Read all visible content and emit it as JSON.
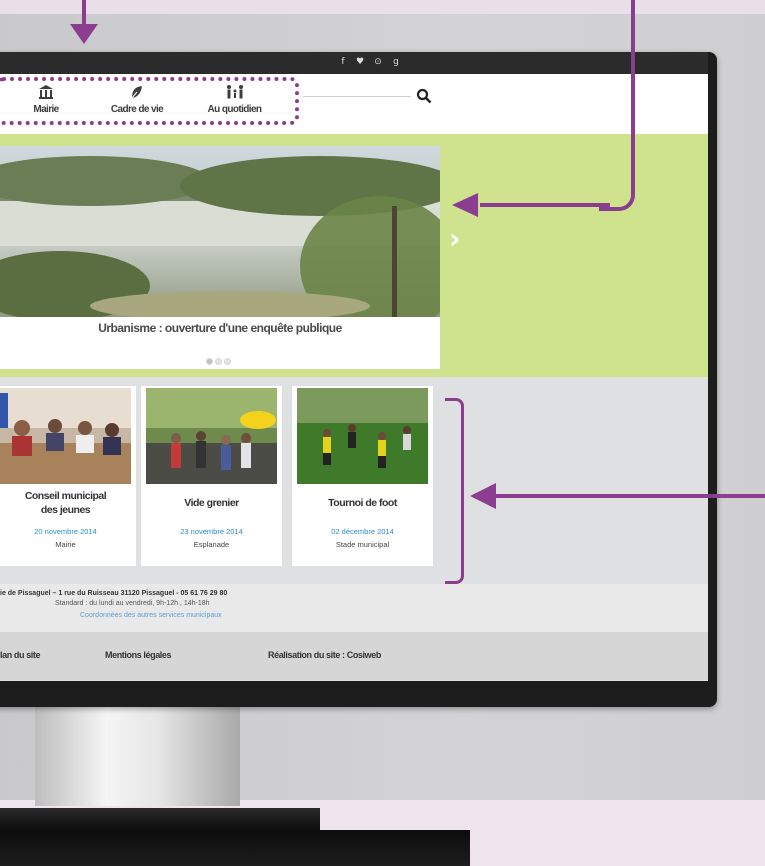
{
  "nav": {
    "items": [
      {
        "label": "Mairie",
        "icon": "town-hall-icon"
      },
      {
        "label": "Cadre de vie",
        "icon": "leaf-icon"
      },
      {
        "label": "Au quotidien",
        "icon": "family-icon"
      }
    ],
    "search_icon": "search-icon"
  },
  "social_icons": [
    "facebook-icon",
    "twitter-icon",
    "pinterest-icon",
    "google-plus-icon"
  ],
  "hero": {
    "caption": "Urbanisme : ouverture d'une enquête publique",
    "slide_count": 3,
    "active_slide": 1,
    "next_symbol": "›"
  },
  "news": [
    {
      "title_line1": "Conseil municipal",
      "title_line2": "des jeunes",
      "date": "20 novembre 2014",
      "place": "Mairie"
    },
    {
      "title_line1": "Vide grenier",
      "title_line2": "",
      "date": "23 novembre 2014",
      "place": "Esplanade"
    },
    {
      "title_line1": "Tournoi de foot",
      "title_line2": "",
      "date": "02 décembre 2014",
      "place": "Stade municipal"
    }
  ],
  "footer": {
    "address": "ie de Pissaguel – 1 rue du Ruisseau 31120 Pissaguel - 05 61 76 29 80",
    "hours": "Standard : du lundi au vendredi, 9h-12h , 14h-18h",
    "link": "Coordonnées des autres services municipaux",
    "links": [
      "lan du site",
      "Mentions légales",
      "Réalisation du site : Cosiweb"
    ]
  },
  "colors": {
    "accent": "#8b3d8f",
    "hero_green": "#cfe28e",
    "date_blue": "#2a8ed0"
  }
}
